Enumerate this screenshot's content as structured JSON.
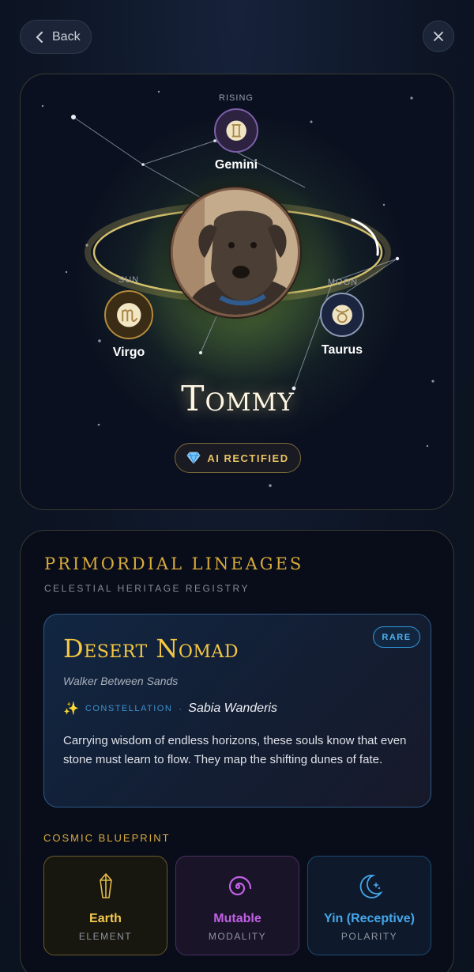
{
  "nav": {
    "back_label": "Back",
    "back_icon": "chevron-left-icon",
    "close_icon": "close-icon"
  },
  "profile": {
    "name": "Tommy",
    "badge": "AI RECTIFIED",
    "badge_icon": "gem-icon",
    "rising": {
      "label": "RISING",
      "sign": "Gemini",
      "icon": "gemini-icon"
    },
    "sun": {
      "label": "SUN",
      "sign": "Virgo",
      "icon": "virgo-icon"
    },
    "moon": {
      "label": "MOON",
      "sign": "Taurus",
      "icon": "taurus-icon"
    }
  },
  "lineage": {
    "title": "PRIMORDIAL LINEAGES",
    "subtitle": "CELESTIAL HERITAGE REGISTRY",
    "card": {
      "title": "Desert Nomad",
      "rarity": "RARE",
      "subtitle": "Walker Between Sands",
      "constellation_label": "CONSTELLATION",
      "constellation_name": "Sabia Wanderis",
      "description": "Carrying wisdom of endless horizons, these souls know that even stone must learn to flow. They map the shifting dunes of fate."
    },
    "blueprint": {
      "title": "COSMIC BLUEPRINT",
      "items": [
        {
          "value": "Earth",
          "label": "ELEMENT",
          "icon": "crystal-icon",
          "color": "#f2c94c"
        },
        {
          "value": "Mutable",
          "label": "MODALITY",
          "icon": "spiral-icon",
          "color": "#c061e6"
        },
        {
          "value": "Yin (Receptive)",
          "label": "POLARITY",
          "icon": "moon-stars-icon",
          "color": "#45a7ea"
        }
      ]
    }
  }
}
